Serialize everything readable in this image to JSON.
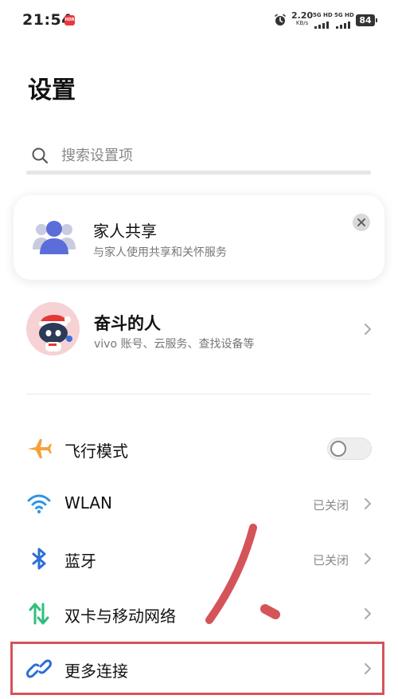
{
  "status_bar": {
    "time": "21:54",
    "notif_badge": "HDR",
    "net_speed": "2.20",
    "net_unit": "KB/s",
    "sim1_label": "5G HD",
    "sim2_label": "5G HD",
    "battery": "84"
  },
  "page": {
    "title": "设置"
  },
  "search": {
    "placeholder": "搜索设置项"
  },
  "family_card": {
    "title": "家人共享",
    "subtitle": "与家人使用共享和关怀服务",
    "icon": "family-people-icon",
    "close_icon": "close-icon"
  },
  "account": {
    "name": "奋斗的人",
    "subtitle": "vivo 账号、云服务、查找设备等"
  },
  "settings": [
    {
      "label": "飞行模式",
      "icon": "airplane-icon",
      "control": "toggle",
      "enabled": false,
      "color": "#f5a13b"
    },
    {
      "label": "WLAN",
      "icon": "wifi-icon",
      "value": "已关闭",
      "color": "#2f95e8"
    },
    {
      "label": "蓝牙",
      "icon": "bluetooth-icon",
      "value": "已关闭",
      "color": "#2a6fd6"
    },
    {
      "label": "双卡与移动网络",
      "icon": "mobile-network-icon",
      "color": "#2fbf7a"
    },
    {
      "label": "更多连接",
      "icon": "link-icon",
      "color": "#2a6fd6",
      "highlighted": true
    }
  ],
  "colors": {
    "accent": "#2a6fd6",
    "highlight": "#d4545a"
  }
}
